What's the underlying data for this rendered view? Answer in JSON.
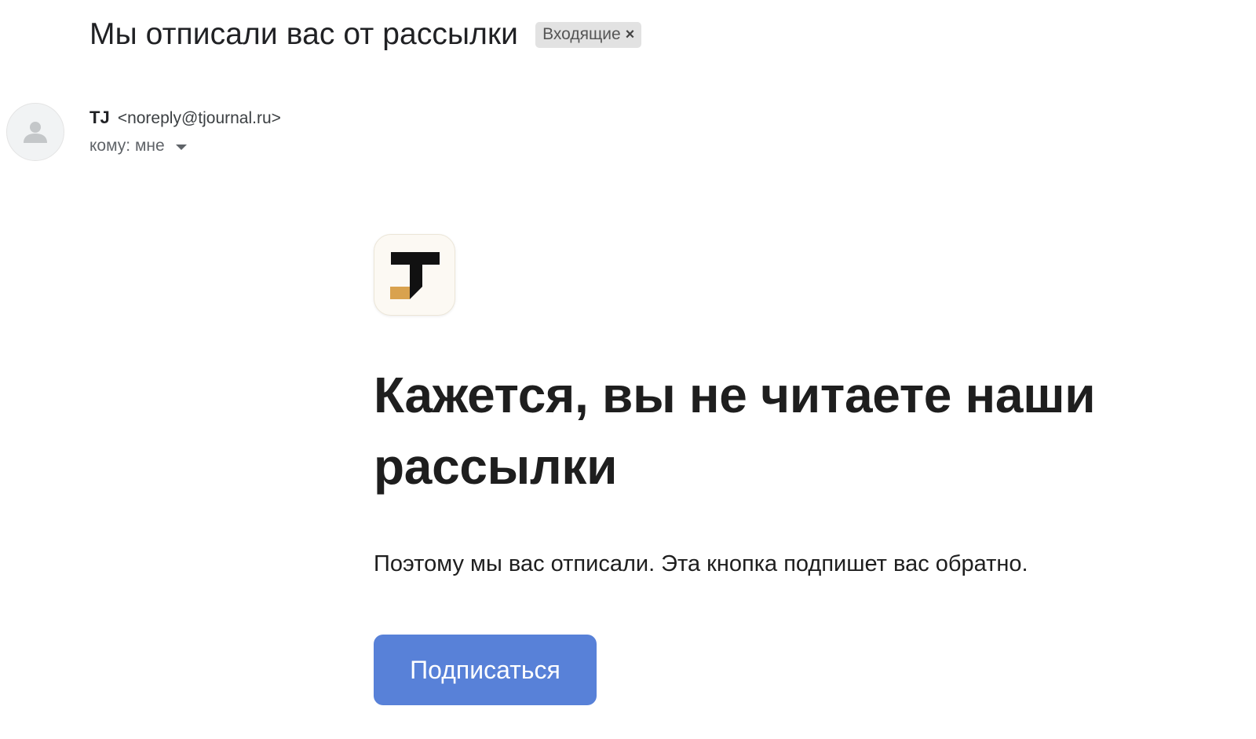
{
  "email": {
    "subject": "Мы отписали вас от рассылки",
    "label": {
      "text": "Входящие",
      "remove_glyph": "×"
    },
    "sender": {
      "name": "TJ",
      "email": "<noreply@tjournal.ru>",
      "avatar_icon": "person-icon"
    },
    "recipient": {
      "text": "кому: мне",
      "expand_icon": "caret-down-icon"
    }
  },
  "message": {
    "logo_icon": "tj-logo-icon",
    "headline": "Кажется, вы не читаете наши рассылки",
    "body": "Поэтому мы вас отписали. Эта кнопка подпишет вас обратно.",
    "button_label": "Подписаться"
  },
  "colors": {
    "button": "#5881d8",
    "chip_background": "#e2e2e2",
    "logo_accent": "#d9a24e",
    "logo_background": "#fcf9f3"
  }
}
